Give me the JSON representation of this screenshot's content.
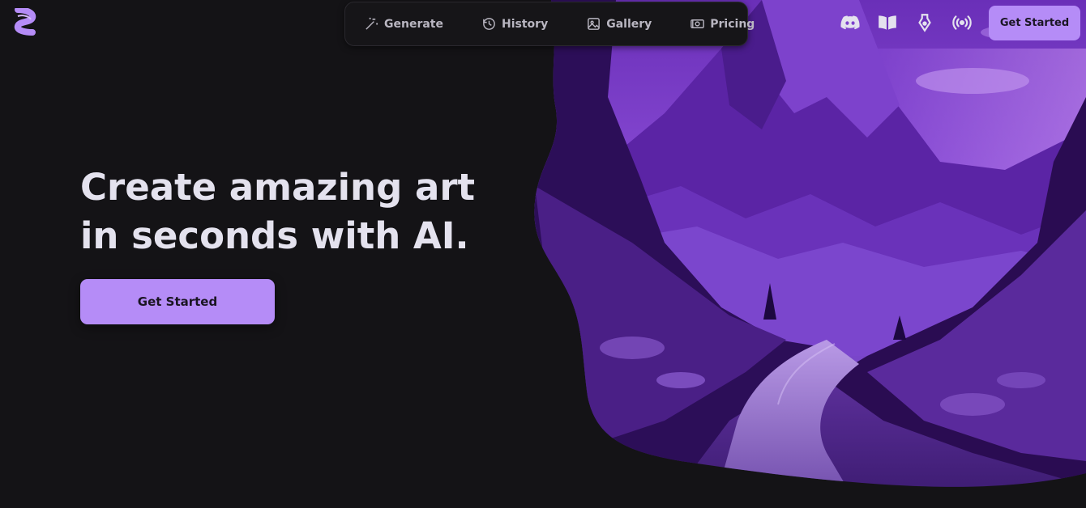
{
  "nav": {
    "items": [
      {
        "label": "Generate",
        "icon": "magic-wand-icon"
      },
      {
        "label": "History",
        "icon": "history-icon"
      },
      {
        "label": "Gallery",
        "icon": "gallery-icon"
      },
      {
        "label": "Pricing",
        "icon": "pricing-icon"
      }
    ]
  },
  "header": {
    "cta_label": "Get Started",
    "icons": [
      "discord-icon",
      "book-icon",
      "pen-nib-icon",
      "broadcast-icon"
    ]
  },
  "hero": {
    "headline_line1": "Create amazing art",
    "headline_line2": "in seconds with AI.",
    "cta_label": "Get Started"
  },
  "colors": {
    "background": "#141316",
    "accent": "#b58cf7",
    "nav_text": "#b9b6c1",
    "headline": "#e4e2ee"
  }
}
